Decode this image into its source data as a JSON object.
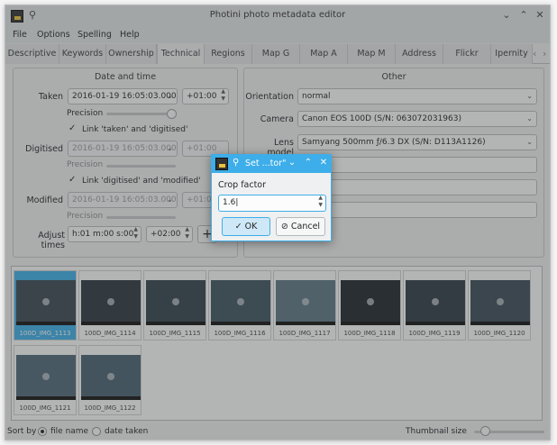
{
  "window": {
    "title": "Photini photo metadata editor",
    "pin_icon": "pin-icon",
    "controls": [
      "⌄",
      "⌃",
      "✕"
    ]
  },
  "menu": [
    "File",
    "Options",
    "Spelling",
    "Help"
  ],
  "tabs": [
    "Descriptive",
    "Keywords",
    "Ownership",
    "Technical",
    "Regions",
    "Map G",
    "Map A",
    "Map M",
    "Address",
    "Flickr",
    "Ipernity"
  ],
  "active_tab": "Technical",
  "datetime": {
    "group_title": "Date and time",
    "taken_label": "Taken",
    "taken_value": "2016-01-19 16:05:03.000",
    "taken_tz": "+01:00",
    "precision_label": "Precision",
    "link_taken_digitised": "Link 'taken' and 'digitised'",
    "digitised_label": "Digitised",
    "digitised_value": "2016-01-19 16:05:03.000",
    "digitised_tz": "+01:00",
    "link_digitised_modified": "Link 'digitised' and 'modified'",
    "modified_label": "Modified",
    "modified_value": "2016-01-19 16:05:03.000",
    "modified_tz": "+01:00",
    "adjust_label": "Adjust times",
    "adjust_value": "h:01 m:00 s:00",
    "adjust_tz": "+02:00",
    "add_symbol": "+"
  },
  "other": {
    "group_title": "Other",
    "orientation_label": "Orientation",
    "orientation_value": "normal",
    "camera_label": "Camera",
    "camera_value": "Canon EOS 100D (S/N: 063072031963)",
    "lens_label": "Lens model",
    "lens_value": "Samyang 500mm ƒ/6.3 DX (S/N: D113A1126)"
  },
  "thumbnails": [
    "100D_IMG_1113",
    "100D_IMG_1114",
    "100D_IMG_1115",
    "100D_IMG_1116",
    "100D_IMG_1117",
    "100D_IMG_1118",
    "100D_IMG_1119",
    "100D_IMG_1120",
    "100D_IMG_1121",
    "100D_IMG_1122"
  ],
  "statusbar": {
    "sort_label": "Sort by",
    "sort_file_name": "file name",
    "sort_date_taken": "date taken",
    "thumb_size_label": "Thumbnail size"
  },
  "dialog": {
    "title": "Set ...tor\"",
    "field_label": "Crop factor",
    "field_value": "1.6",
    "ok_label": "OK",
    "cancel_label": "Cancel"
  },
  "colors": {
    "accent": "#3daee9",
    "window_bg": "#eff0f1"
  }
}
